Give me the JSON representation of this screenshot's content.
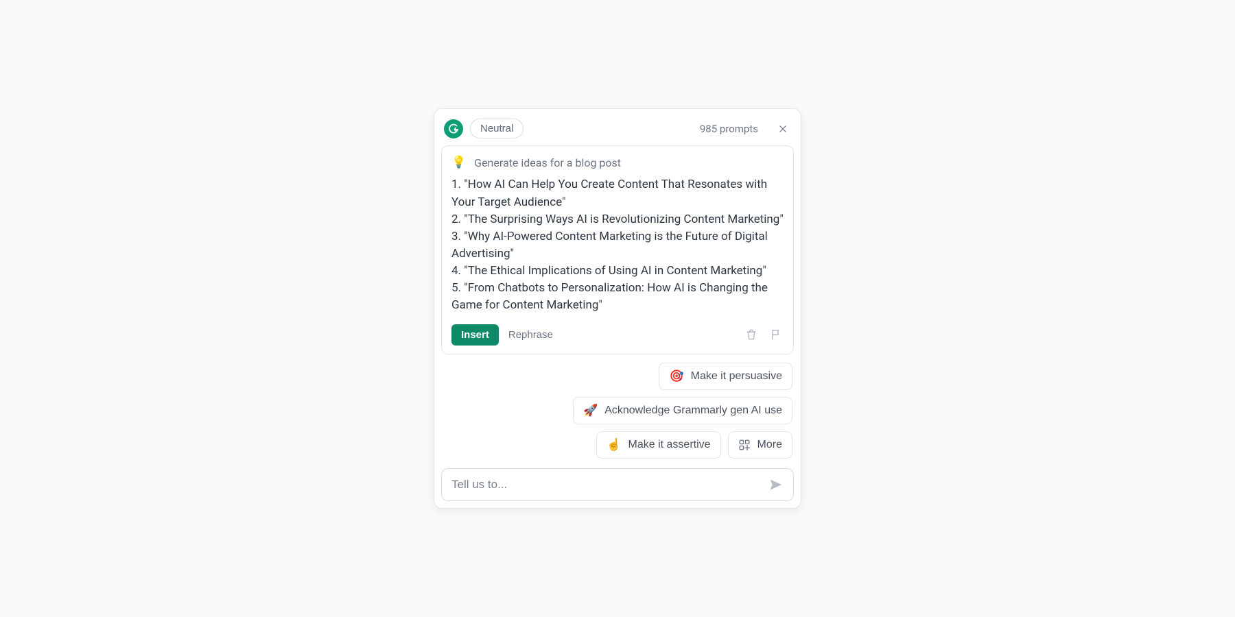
{
  "header": {
    "tone_label": "Neutral",
    "prompts_count": "985 prompts"
  },
  "prompt": {
    "icon": "lightbulb-icon",
    "label": "Generate ideas for a blog post"
  },
  "ideas": [
    "1. \"How AI Can Help You Create Content That Resonates with Your Target Audience\"",
    "2. \"The Surprising Ways AI is Revolutionizing Content Marketing\"",
    "3. \"Why AI-Powered Content Marketing is the Future of Digital Advertising\"",
    "4. \"The Ethical Implications of Using AI in Content Marketing\"",
    "5. \"From Chatbots to Personalization: How AI is Changing the Game for Content Marketing\""
  ],
  "actions": {
    "insert": "Insert",
    "rephrase": "Rephrase"
  },
  "chips": {
    "persuasive": "Make it persuasive",
    "acknowledge": "Acknowledge Grammarly gen AI use",
    "assertive": "Make it assertive",
    "more": "More"
  },
  "input": {
    "placeholder": "Tell us to..."
  },
  "colors": {
    "brand": "#0f9d75",
    "primary_button": "#0f8a68"
  }
}
